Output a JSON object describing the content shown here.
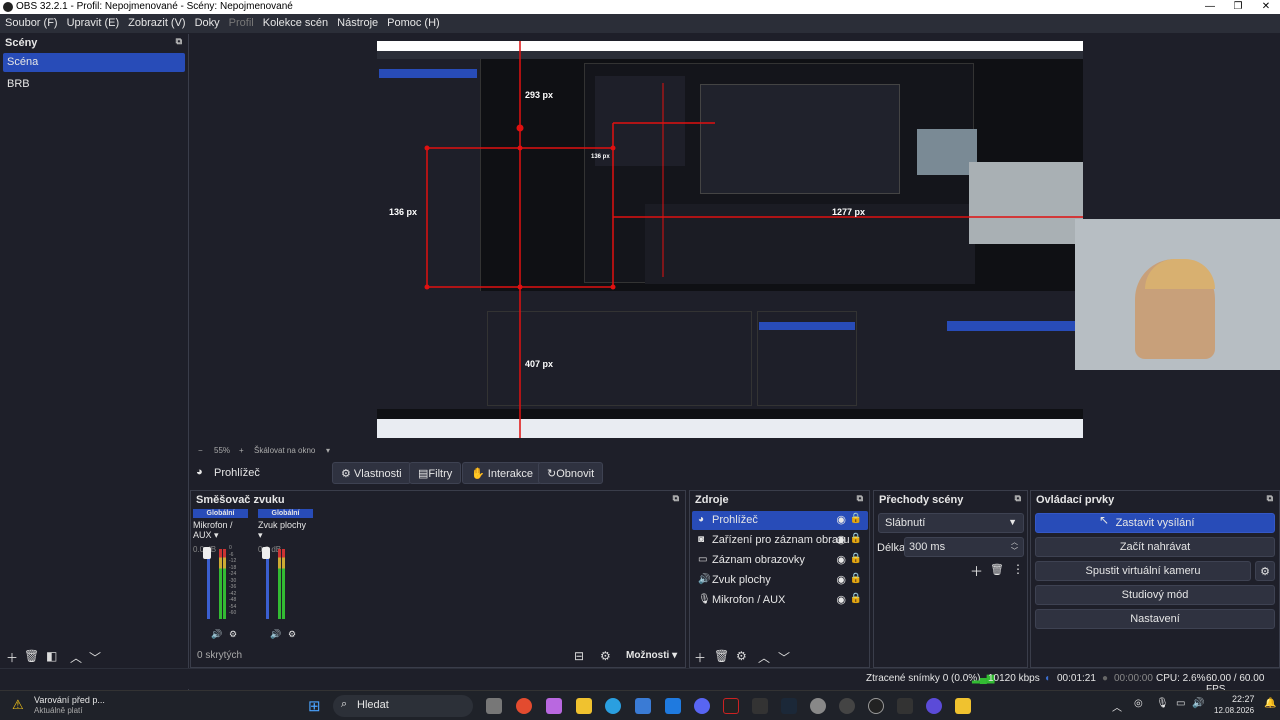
{
  "window": {
    "title": "OBS 32.2.1 - Profil: Nepojmenované - Scény: Nepojmenované"
  },
  "menu": [
    "Soubor (F)",
    "Upravit (E)",
    "Zobrazit (V)",
    "Doky",
    "Profil",
    "Kolekce scén",
    "Nástroje",
    "Pomoc (H)"
  ],
  "scenes": {
    "title": "Scény",
    "items": [
      "Scéna",
      "BRB"
    ]
  },
  "preview": {
    "measure_top": "293 px",
    "measure_left": "136 px",
    "measure_right": "1277 px",
    "measure_bottom": "407 px",
    "nested_measure_left": "136 px"
  },
  "zoombar": {
    "minus": "−",
    "zoom": "55%",
    "plus": "+",
    "mode": "Škálovat na okno"
  },
  "context": {
    "source_name": "Prohlížeč",
    "properties": "Vlastnosti",
    "filters": "Filtry",
    "interact": "Interakce",
    "refresh": "Obnovit"
  },
  "mixer": {
    "title": "Směšovač zvuku",
    "hidden": "0 skrytých",
    "channels": [
      {
        "scope": "Globální",
        "name": "Mikrofon / AUX",
        "db": "0.0 dB"
      },
      {
        "scope": "Globální",
        "name": "Zvuk plochy",
        "db": "0.0 dB"
      }
    ],
    "scale": [
      "0",
      "-6",
      "-12",
      "-18",
      "-24",
      "-30",
      "-36",
      "-42",
      "-48",
      "-54",
      "-60"
    ]
  },
  "sources": {
    "title": "Zdroje",
    "options": "Možnosti",
    "items": [
      "Prohlížeč",
      "Zařízení pro záznam obrazu",
      "Záznam obrazovky",
      "Zvuk plochy",
      "Mikrofon / AUX"
    ]
  },
  "transitions": {
    "title": "Přechody scény",
    "selected": "Slábnutí",
    "duration_label": "Délka",
    "duration_value": "300 ms"
  },
  "controls": {
    "title": "Ovládací prvky",
    "buttons": [
      "Zastavit vysílání",
      "Začít nahrávat",
      "Spustit virtuální kameru",
      "Studiový mód",
      "Nastavení"
    ]
  },
  "status": {
    "dropped": "Ztracené snímky 0 (0.0%)",
    "bitrate": "10120 kbps",
    "stream_time": "00:01:21",
    "rec_time": "00:00:00",
    "cpu": "CPU: 2.6%",
    "fps": "60.00 / 60.00 FPS"
  },
  "taskbar": {
    "warning_title": "Varování před p...",
    "warning_sub": "Aktuálně platí",
    "search": "Hledat",
    "time": "22:27",
    "date": "12.08.2026"
  },
  "colors": {
    "accent": "#284cb8",
    "bg": "#1e1f29",
    "measure": "#e01010"
  }
}
